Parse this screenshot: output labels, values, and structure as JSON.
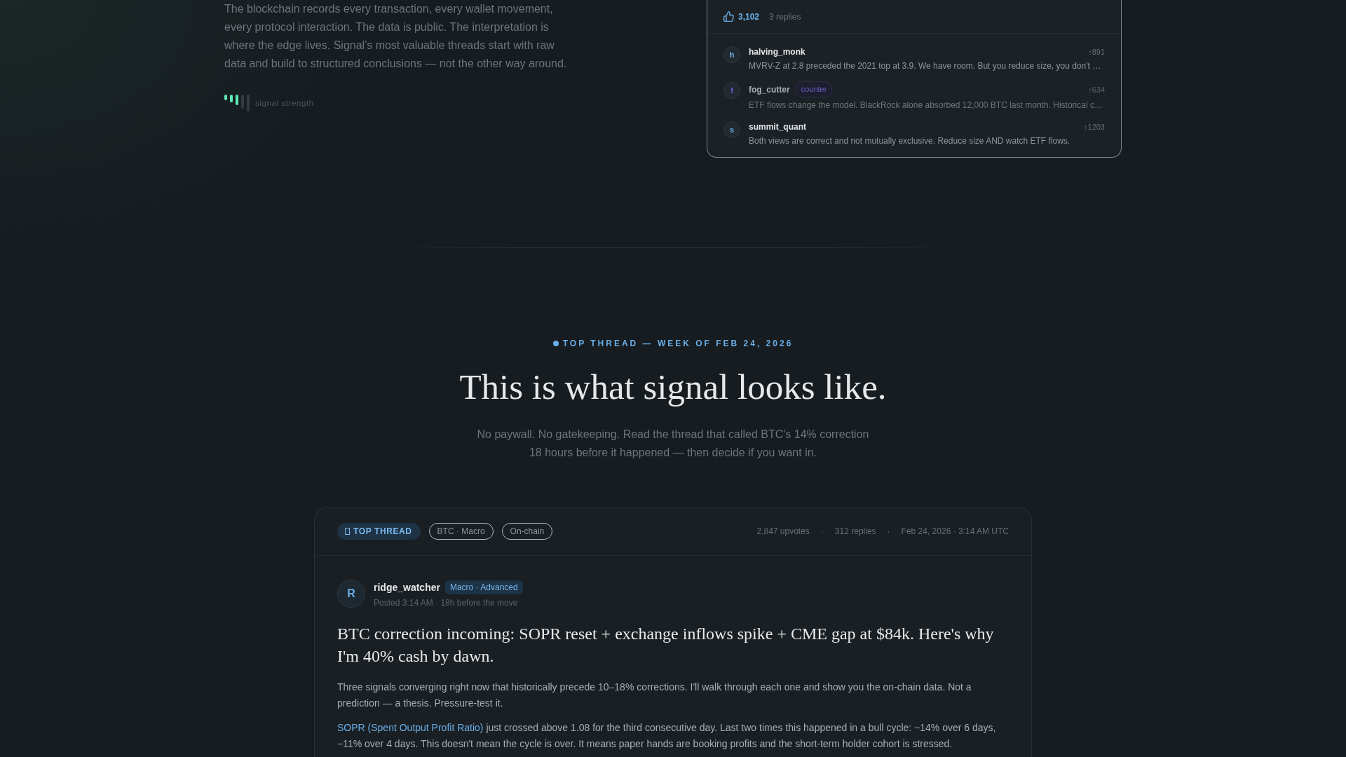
{
  "intro": {
    "paragraph": "The blockchain records every transaction, every wallet movement, every protocol interaction. The data is public. The interpretation is where the edge lives. Signal's most valuable threads start with raw data and build to structured conclusions — not the other way around.",
    "signal_label": "signal strength"
  },
  "thread_preview": {
    "upvotes": "3,102",
    "reply_count": "3 replies",
    "replies": [
      {
        "initial": "h",
        "color": "#6aaee8",
        "author": "halving_monk",
        "score": "↑891",
        "dimmed": false,
        "text": "MVRV-Z at 2.8 preceded the 2021 top at 3.9. We have room. But you reduce size, you don't …"
      },
      {
        "initial": "f",
        "color": "#6d5fd0",
        "author": "fog_cutter",
        "tag": "counter",
        "score": "↑634",
        "dimmed": true,
        "text": "ETF flows change the model. BlackRock alone absorbed 12,000 BTC last month. Historical c…"
      },
      {
        "initial": "s",
        "color": "#6aaee8",
        "author": "summit_quant",
        "score": "↑1203",
        "dimmed": false,
        "text": "Both views are correct and not mutually exclusive. Reduce size AND watch ETF flows."
      }
    ]
  },
  "featured": {
    "eyebrow": "TOP THREAD — WEEK OF FEB 24, 2026",
    "heading": "This is what signal looks like.",
    "subtitle": "No paywall. No gatekeeping. Read the thread that called BTC's 14% correction 18 hours before it happened — then decide if you want in."
  },
  "thread": {
    "badge": "TOP THREAD",
    "tags": [
      "BTC · Macro",
      "On-chain"
    ],
    "meta": [
      {
        "kind": "stat",
        "text": "2,847 upvotes"
      },
      {
        "kind": "separator",
        "text": "·"
      },
      {
        "kind": "stat",
        "text": "312 replies"
      },
      {
        "kind": "separator",
        "text": "·"
      },
      {
        "kind": "date",
        "text": "Feb 24, 2026 · 3:14 AM UTC"
      }
    ],
    "author": {
      "initial": "R",
      "name": "ridge_watcher",
      "badge": "Macro · Advanced",
      "posted": "Posted 3:14 AM · 18h before the move"
    },
    "title": "BTC correction incoming: SOPR reset + exchange inflows spike + CME gap at $84k. Here's why I'm 40% cash by dawn.",
    "body": [
      {
        "text": "Three signals converging right now that historically precede 10–18% corrections. I'll walk through each one and show you the on-chain data. Not a prediction — a thesis. Pressure-test it."
      },
      {
        "link": "SOPR (Spent Output Profit Ratio)",
        "text": "just crossed above 1.08 for the third consecutive day. Last two times this happened in a bull cycle: −14% over 6 days, −11% over 4 days. This doesn't mean the cycle is over. It means paper hands are booking profits and the short-term holder cohort is stressed."
      }
    ]
  }
}
